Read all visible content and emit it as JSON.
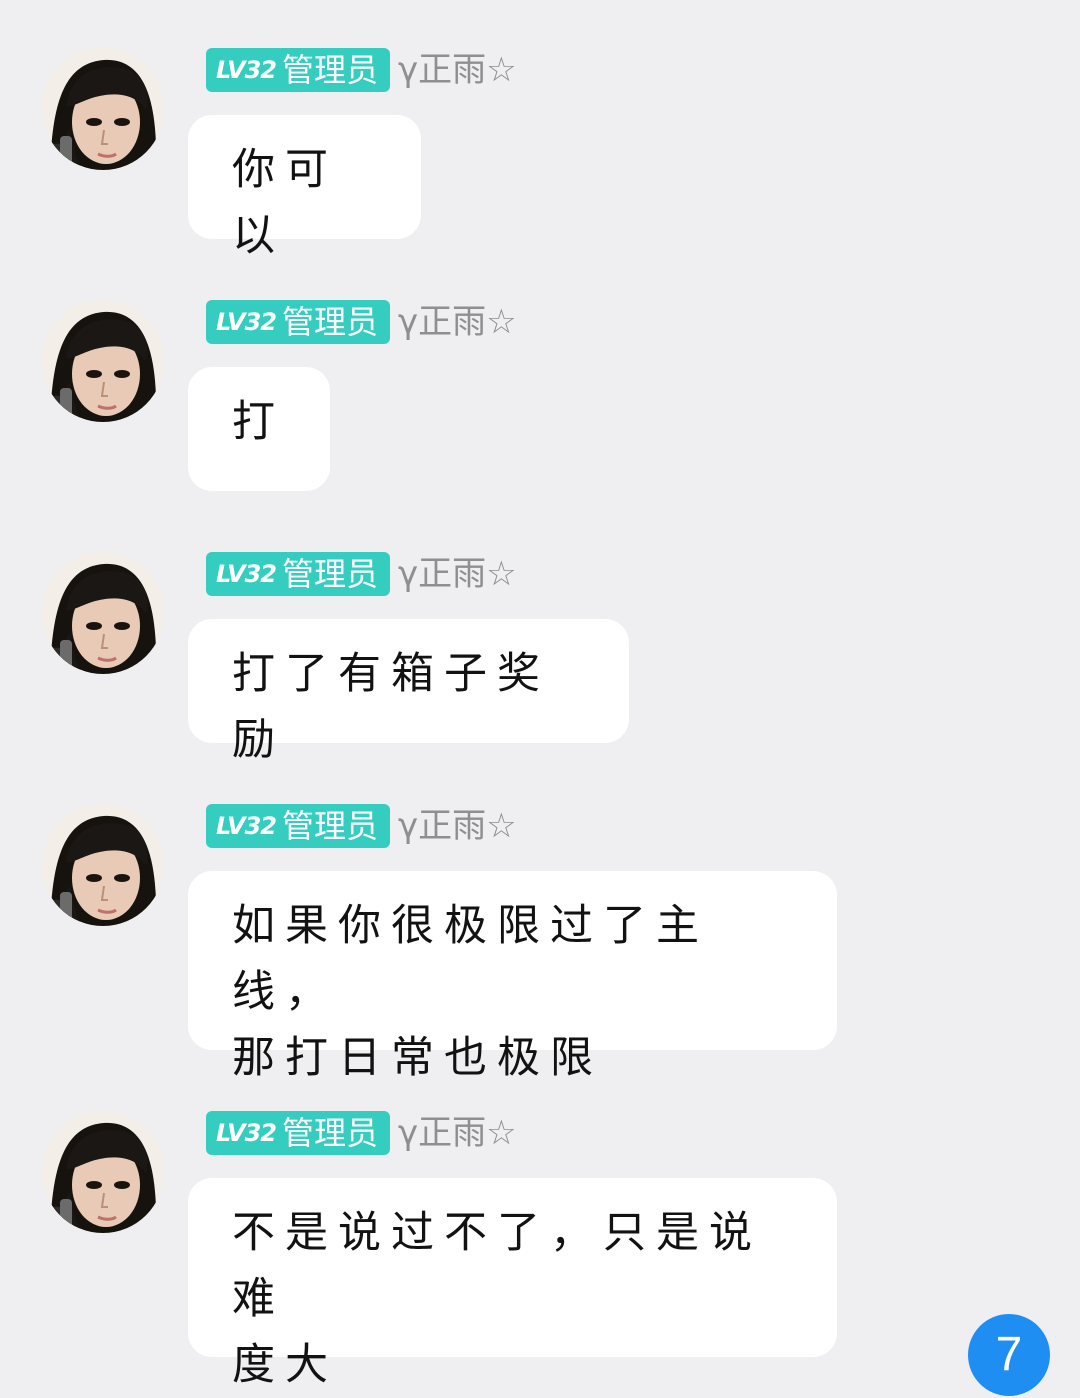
{
  "messages": [
    {
      "level": "LV32",
      "role": "管理员",
      "username": "γ正雨☆",
      "text": "你可以"
    },
    {
      "level": "LV32",
      "role": "管理员",
      "username": "γ正雨☆",
      "text": "打"
    },
    {
      "level": "LV32",
      "role": "管理员",
      "username": "γ正雨☆",
      "text": "打了有箱子奖励"
    },
    {
      "level": "LV32",
      "role": "管理员",
      "username": "γ正雨☆",
      "text": "如果你很极限过了主线，\n那打日常也极限"
    },
    {
      "level": "LV32",
      "role": "管理员",
      "username": "γ正雨☆",
      "text": "不是说过不了，只是说难\n度大"
    }
  ],
  "unread_count": "7",
  "colors": {
    "background": "#efeff1",
    "badge": "#34cdbf",
    "bubble": "#ffffff",
    "username": "#8e8e93",
    "unread": "#1f8ef2"
  },
  "icons": {
    "avatar": "user-avatar",
    "unread": "unread-count-badge"
  }
}
